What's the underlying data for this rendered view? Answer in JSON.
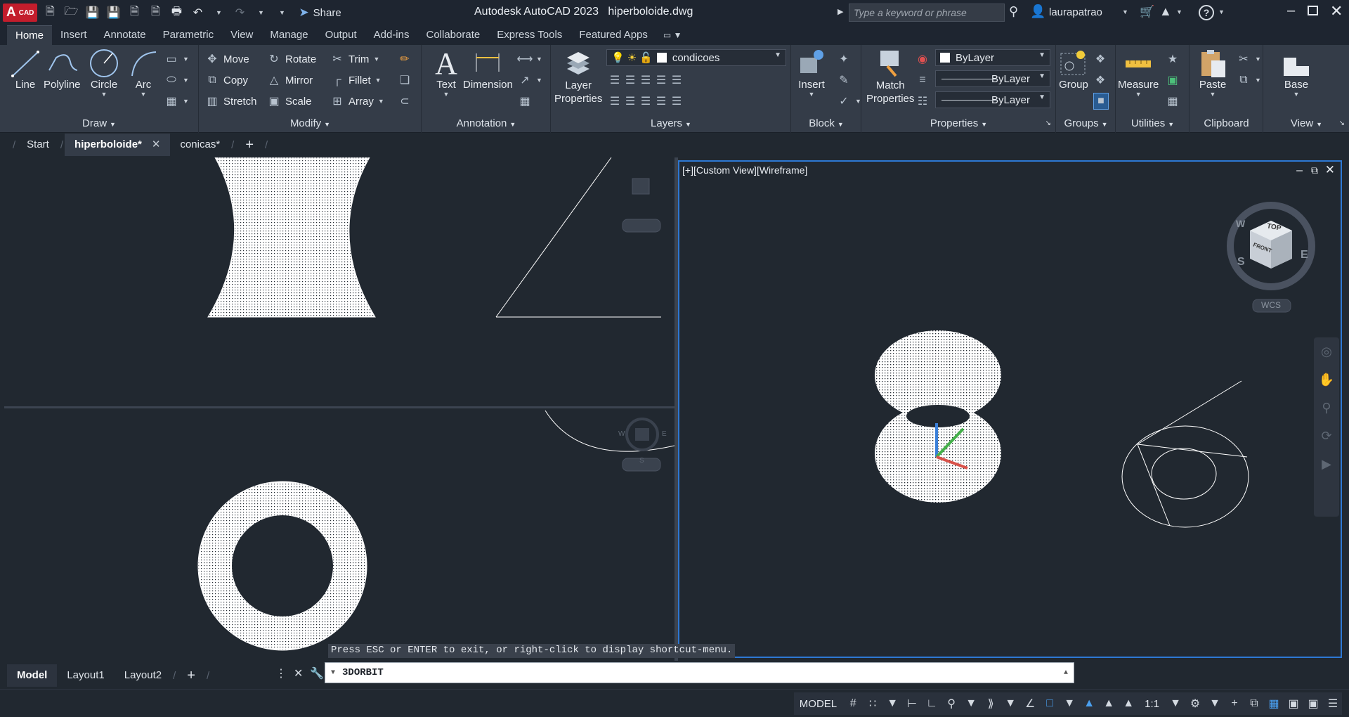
{
  "app": {
    "logo_text": "A",
    "logo_sub": "CAD",
    "title": "Autodesk AutoCAD 2023",
    "filename": "hiperboloide.dwg",
    "share_label": "Share",
    "search_placeholder": "Type a keyword or phrase",
    "username": "laurapatrao"
  },
  "ribbon_tabs": [
    "Home",
    "Insert",
    "Annotate",
    "Parametric",
    "View",
    "Manage",
    "Output",
    "Add-ins",
    "Collaborate",
    "Express Tools",
    "Featured Apps"
  ],
  "ribbon": {
    "draw": {
      "title": "Draw",
      "line": "Line",
      "polyline": "Polyline",
      "circle": "Circle",
      "arc": "Arc"
    },
    "modify": {
      "title": "Modify",
      "move": "Move",
      "rotate": "Rotate",
      "trim": "Trim",
      "copy": "Copy",
      "mirror": "Mirror",
      "fillet": "Fillet",
      "stretch": "Stretch",
      "scale": "Scale",
      "array": "Array"
    },
    "annotation": {
      "title": "Annotation",
      "text": "Text",
      "dimension": "Dimension"
    },
    "layers": {
      "title": "Layers",
      "layer_properties_1": "Layer",
      "layer_properties_2": "Properties",
      "current_layer": "condicoes"
    },
    "block": {
      "title": "Block",
      "insert": "Insert"
    },
    "properties": {
      "title": "Properties",
      "match_1": "Match",
      "match_2": "Properties",
      "color": "ByLayer",
      "linetype": "ByLayer",
      "lineweight": "ByLayer"
    },
    "groups": {
      "title": "Groups",
      "group": "Group"
    },
    "utilities": {
      "title": "Utilities",
      "measure": "Measure"
    },
    "clipboard": {
      "title": "Clipboard",
      "paste": "Paste"
    },
    "view": {
      "title": "View",
      "base": "Base"
    }
  },
  "file_tabs": {
    "start": "Start",
    "active": "hiperboloide*",
    "other": "conicas*"
  },
  "viewports": {
    "right_label": "[+][Custom View][Wireframe]",
    "viewcube_top": "TOP",
    "viewcube_front": "FRONT",
    "compass_s": "S",
    "compass_e": "E",
    "compass_w": "W",
    "wcs": "WCS"
  },
  "command": {
    "hint": "Press ESC or ENTER to exit, or right-click to display shortcut-menu.",
    "current": "3DORBIT"
  },
  "layout_tabs": [
    "Model",
    "Layout1",
    "Layout2"
  ],
  "status": {
    "model": "MODEL",
    "scale": "1:1"
  },
  "colors": {
    "accent": "#2d78d3",
    "logo": "#c31d2c",
    "viewport_bg": "#212830"
  }
}
